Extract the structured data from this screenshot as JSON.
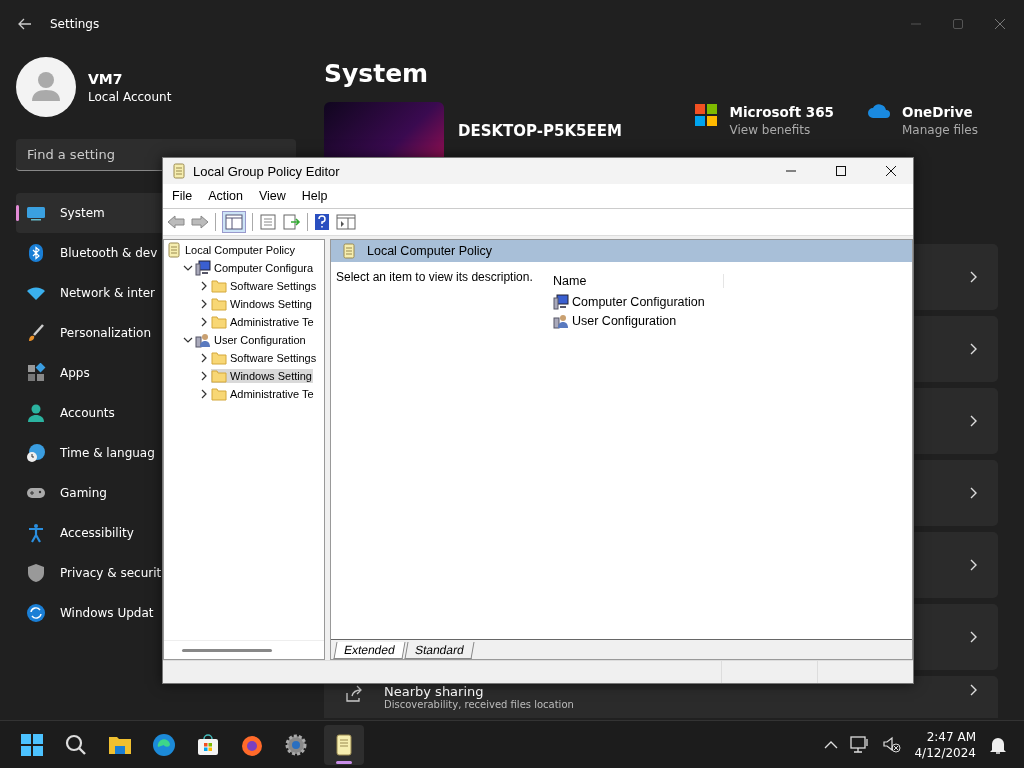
{
  "settings": {
    "title": "Settings"
  },
  "account": {
    "name": "VM7",
    "type": "Local Account"
  },
  "search": {
    "placeholder": "Find a setting"
  },
  "nav": [
    {
      "label": "System",
      "kind": "system",
      "selected": true
    },
    {
      "label": "Bluetooth & dev",
      "kind": "bluetooth",
      "selected": false
    },
    {
      "label": "Network & inter",
      "kind": "wifi",
      "selected": false
    },
    {
      "label": "Personalization",
      "kind": "brush",
      "selected": false
    },
    {
      "label": "Apps",
      "kind": "apps",
      "selected": false
    },
    {
      "label": "Accounts",
      "kind": "person",
      "selected": false
    },
    {
      "label": "Time & languag",
      "kind": "clock",
      "selected": false
    },
    {
      "label": "Gaming",
      "kind": "gamepad",
      "selected": false
    },
    {
      "label": "Accessibility",
      "kind": "access",
      "selected": false
    },
    {
      "label": "Privacy & securit",
      "kind": "shield",
      "selected": false
    },
    {
      "label": "Windows Updat",
      "kind": "update",
      "selected": false
    }
  ],
  "page": {
    "title": "System",
    "device_name": "DESKTOP-P5K5EEM",
    "links": [
      {
        "title": "Microsoft 365",
        "subtitle": "View benefits",
        "kind": "tiles"
      },
      {
        "title": "OneDrive",
        "subtitle": "Manage files",
        "kind": "cloud"
      }
    ]
  },
  "cards": [
    {
      "title": "Nearby sharing",
      "subtitle": "Discoverability, received files location"
    }
  ],
  "gpe": {
    "title": "Local Group Policy Editor",
    "menu": [
      "File",
      "Action",
      "View",
      "Help"
    ],
    "tree": [
      {
        "label": "Local Computer Policy",
        "kind": "policy",
        "selected": false,
        "children": [
          {
            "label": "Computer Configura",
            "kind": "computer",
            "expanded": true,
            "selected": false,
            "children": [
              {
                "label": "Software Settings",
                "kind": "folder",
                "expanded": false,
                "selected": false
              },
              {
                "label": "Windows Setting",
                "kind": "folder",
                "expanded": false,
                "selected": false
              },
              {
                "label": "Administrative Te",
                "kind": "folder",
                "expanded": false,
                "selected": false
              }
            ]
          },
          {
            "label": "User Configuration",
            "kind": "user",
            "expanded": true,
            "selected": false,
            "children": [
              {
                "label": "Software Settings",
                "kind": "folder",
                "expanded": false,
                "selected": false
              },
              {
                "label": "Windows Setting",
                "kind": "folder",
                "expanded": false,
                "selected": true
              },
              {
                "label": "Administrative Te",
                "kind": "folder",
                "expanded": false,
                "selected": false
              }
            ]
          }
        ]
      }
    ],
    "detail": {
      "header": "Local Computer Policy",
      "description": "Select an item to view its description.",
      "column": "Name",
      "items": [
        {
          "label": "Computer Configuration",
          "kind": "computer"
        },
        {
          "label": "User Configuration",
          "kind": "user"
        }
      ]
    },
    "tabs": [
      {
        "label": "Extended",
        "selected": true
      },
      {
        "label": "Standard",
        "selected": false
      }
    ]
  },
  "taskbar": {
    "apps": [
      {
        "kind": "start",
        "active": false
      },
      {
        "kind": "search",
        "active": false
      },
      {
        "kind": "folder",
        "active": false
      },
      {
        "kind": "edge",
        "active": false
      },
      {
        "kind": "store",
        "active": false
      },
      {
        "kind": "firefox",
        "active": false
      },
      {
        "kind": "gear",
        "active": false
      },
      {
        "kind": "scroll",
        "active": true
      }
    ],
    "time": "2:47 AM",
    "date": "4/12/2024"
  }
}
